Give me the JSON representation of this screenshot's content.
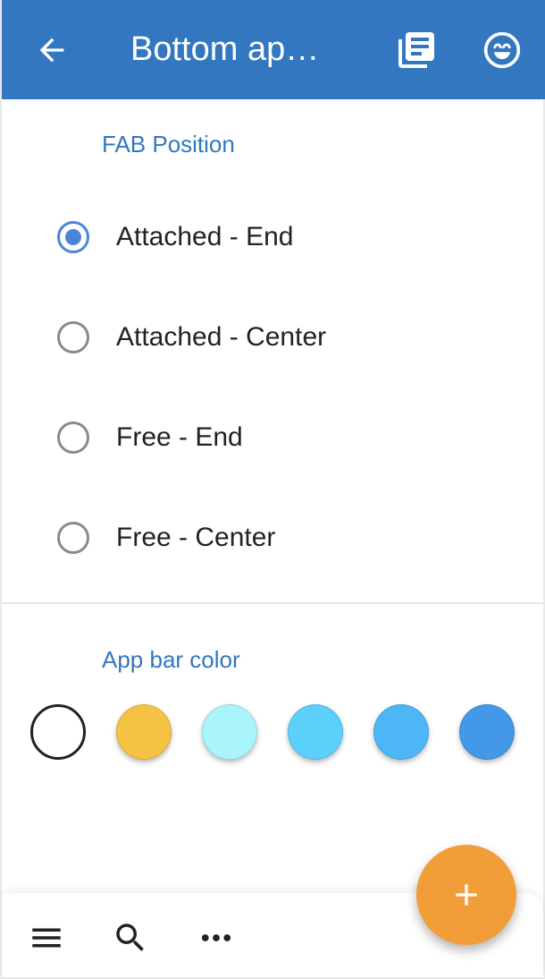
{
  "app_bar": {
    "title": "Bottom ap…",
    "back_icon": "arrow-left-icon",
    "action_icons": [
      "library-books-icon",
      "smiley-face-icon"
    ],
    "color": "#3277c0"
  },
  "fab_position": {
    "header": "FAB Position",
    "options": [
      {
        "label": "Attached - End",
        "checked": true
      },
      {
        "label": "Attached - Center",
        "checked": false
      },
      {
        "label": "Free - End",
        "checked": false
      },
      {
        "label": "Free - Center",
        "checked": false
      }
    ]
  },
  "app_bar_color": {
    "header": "App bar color",
    "swatches": [
      {
        "color": "#ffffff",
        "selected": true
      },
      {
        "color": "#f6c244",
        "selected": false
      },
      {
        "color": "#a9f5fb",
        "selected": false
      },
      {
        "color": "#5bd0fa",
        "selected": false
      },
      {
        "color": "#4cb6f7",
        "selected": false
      },
      {
        "color": "#4399e7",
        "selected": false
      }
    ]
  },
  "bottom_bar": {
    "icons": [
      "menu-icon",
      "search-icon",
      "more-horizontal-icon"
    ]
  },
  "fab": {
    "icon": "plus-icon",
    "color": "#f19d38"
  }
}
